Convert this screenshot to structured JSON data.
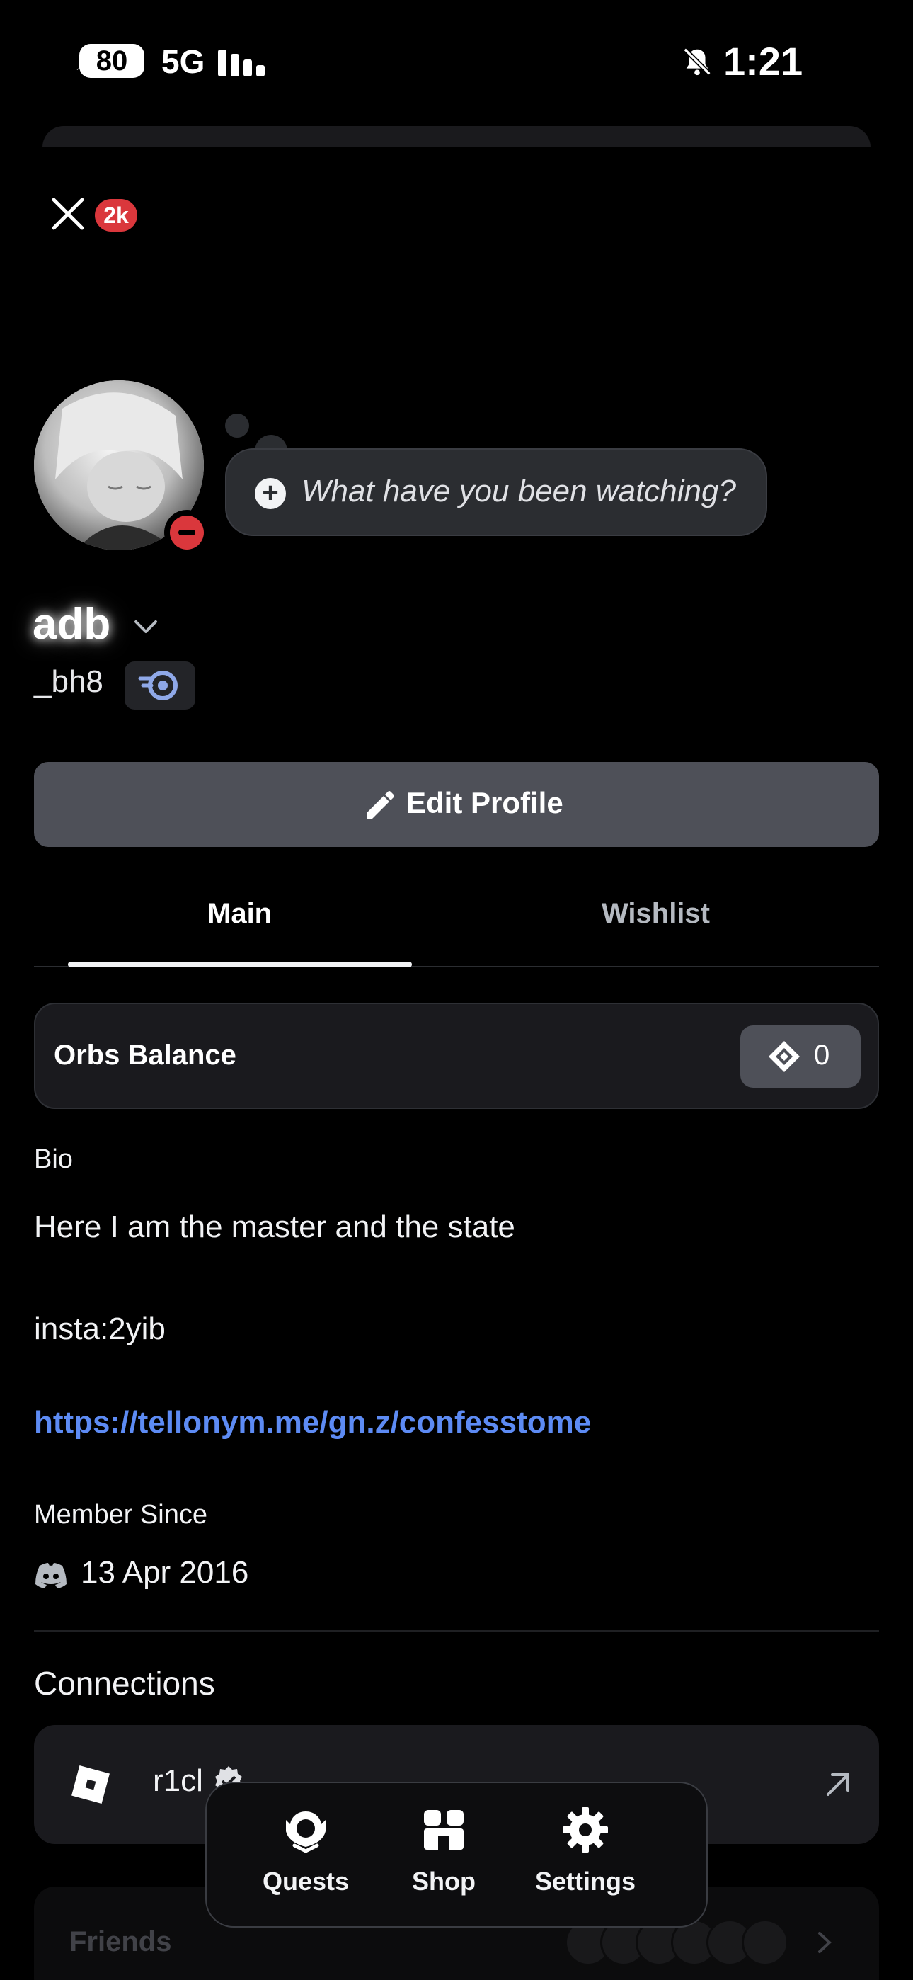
{
  "status_bar": {
    "battery": "80",
    "network": "5G",
    "time": "1:21"
  },
  "header": {
    "notification_count": "2k"
  },
  "profile": {
    "status_prompt": "What have you been watching?",
    "display_name": "adb",
    "username": "_bh8",
    "edit_profile_label": "Edit Profile",
    "online_status": "do-not-disturb"
  },
  "tabs": [
    {
      "label": "Main",
      "active": true
    },
    {
      "label": "Wishlist",
      "active": false
    }
  ],
  "orbs": {
    "label": "Orbs Balance",
    "value": "0"
  },
  "bio": {
    "label": "Bio",
    "lines": [
      "Here I am the master and the state",
      "insta:2yib"
    ],
    "link": "https://tellonym.me/gn.z/confesstome"
  },
  "member_since": {
    "label": "Member Since",
    "date": "13 Apr 2016"
  },
  "connections": {
    "title": "Connections",
    "items": [
      {
        "name": "r1cl",
        "service_icon": "roblox-icon"
      }
    ]
  },
  "friends": {
    "label": "Friends"
  },
  "bottom_nav": [
    {
      "label": "Quests",
      "icon": "quests-icon"
    },
    {
      "label": "Shop",
      "icon": "shop-icon"
    },
    {
      "label": "Settings",
      "icon": "gear-icon"
    }
  ],
  "colors": {
    "background": "#000000",
    "link": "#5d8bf4",
    "badge": "#da373c",
    "button": "#4e5058"
  }
}
